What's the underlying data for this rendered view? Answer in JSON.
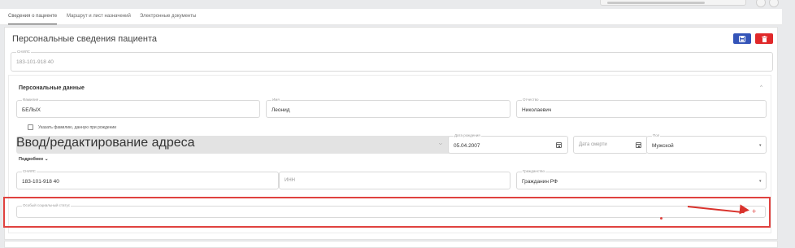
{
  "tabs": [
    {
      "label": "Сведения о пациенте",
      "active": true
    },
    {
      "label": "Маршрут и лист назначений",
      "active": false
    },
    {
      "label": "Электронные документы",
      "active": false
    }
  ],
  "panel": {
    "title": "Персональные сведения пациента"
  },
  "snils_top": {
    "label": "СНИЛС",
    "value": "183-101-918 40"
  },
  "personal": {
    "title": "Персональные данные",
    "lastname": {
      "label": "Фамилия",
      "value": "БЕЛЫХ"
    },
    "firstname": {
      "label": "Имя",
      "value": "Леонид"
    },
    "patronymic": {
      "label": "Отчество",
      "value": "Николаевич"
    },
    "checkbox_label": "Указать фамилию, данную при рождении",
    "address_placeholder": "Ввод/редактирование адреса",
    "birthdate": {
      "label": "Дата рождения",
      "value": "05.04.2007"
    },
    "deathdate": {
      "placeholder": "Дата смерти"
    },
    "gender": {
      "label": "Пол",
      "value": "Мужской"
    },
    "more_label": "Подробнее",
    "snils": {
      "label": "СНИЛС",
      "value": "183-101-918 40"
    },
    "inn": {
      "placeholder": "ИНН"
    },
    "citizenship": {
      "label": "Гражданство",
      "value": "Гражданин РФ"
    },
    "social_status": {
      "label": "Особый социальный статус"
    }
  },
  "colors": {
    "primary": "#3454b8",
    "danger": "#e0282a",
    "highlight": "#e0423f"
  }
}
